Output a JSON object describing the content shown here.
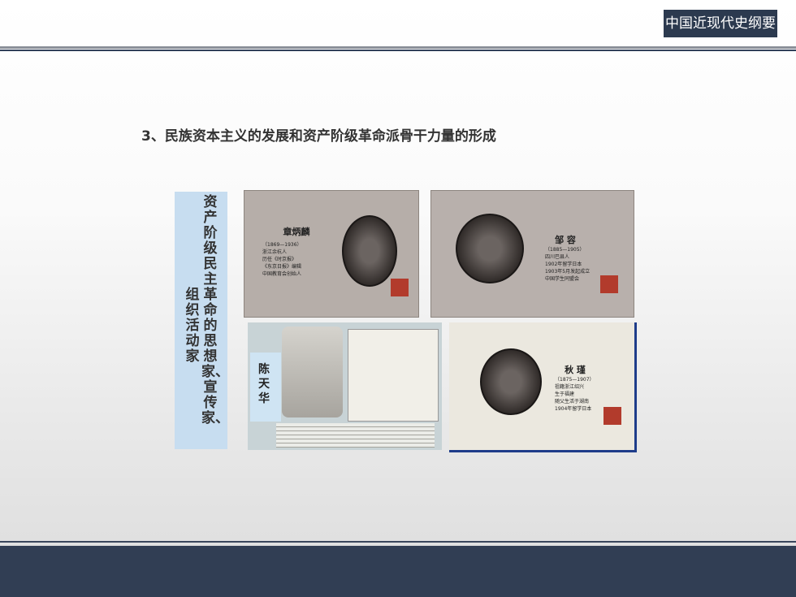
{
  "header": {
    "badge": "中国近现代史纲要"
  },
  "slide": {
    "title": "3、民族资本主义的发展和资产阶级革命派骨干力量的形成",
    "vertical_label": {
      "col_right": "资产阶级民主革命的思想家、宣传家、",
      "col_left": "组织活动家"
    }
  },
  "cards": {
    "zhang": {
      "name": "章炳麟",
      "info": "（1869—1936）\n浙江余杭人\n历任《时京报》\n《东京日报》编辑\n中国教育会创始人"
    },
    "zou": {
      "name": "邹 容",
      "info": "（1885—1905）\n四川巴县人\n1902年留学日本\n1903年5月发起成立\n中国学生同盟会"
    },
    "chen": {
      "name": "陈天华"
    },
    "qiu": {
      "name": "秋 瑾",
      "info": "（1875—1907）\n祖籍浙江绍兴\n生于福建\n随父生活于湖南\n1904年留学日本"
    }
  }
}
